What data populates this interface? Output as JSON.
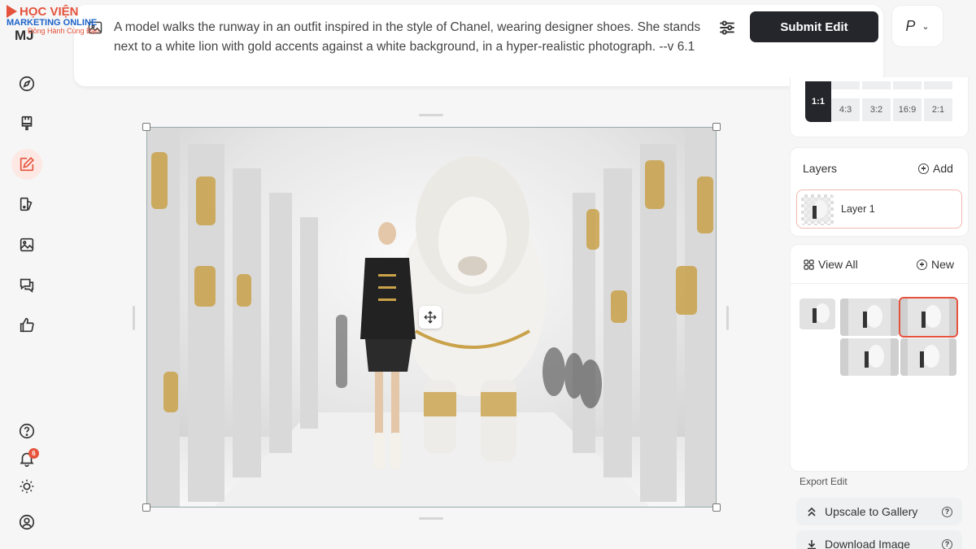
{
  "app": {
    "logo": "MJ"
  },
  "watermark": {
    "line1": "HỌC VIỆN",
    "line2": "MARKETING ONLINE",
    "line3": "Đồng Hành Cùng Bạn"
  },
  "sidebar": {
    "items": [
      {
        "icon": "compass-icon"
      },
      {
        "icon": "paintbrush-icon"
      },
      {
        "icon": "edit-icon",
        "active": true
      },
      {
        "icon": "palette-icon"
      },
      {
        "icon": "image-icon"
      },
      {
        "icon": "chat-icon"
      },
      {
        "icon": "thumbs-up-icon"
      }
    ],
    "bottom": [
      {
        "icon": "help-icon"
      },
      {
        "icon": "bell-icon",
        "badge": "6"
      },
      {
        "icon": "sun-icon"
      },
      {
        "icon": "profile-icon"
      }
    ]
  },
  "prompt": {
    "text": "A model walks the runway in an outfit inspired in the style of Chanel, wearing designer shoes. She stands next to a white lion with gold accents against a white background, in a hyper-realistic photograph. --v 6.1"
  },
  "toolbar": {
    "submit_label": "Submit Edit",
    "profile_label": "P"
  },
  "aspect_ratios": {
    "active": "1:1",
    "options": [
      "4:3",
      "3:2",
      "16:9",
      "2:1"
    ]
  },
  "layers": {
    "title": "Layers",
    "add_label": "Add",
    "items": [
      {
        "label": "Layer 1"
      }
    ]
  },
  "gallery": {
    "view_all_label": "View All",
    "new_label": "New"
  },
  "export": {
    "title": "Export Edit",
    "upscale_label": "Upscale to Gallery",
    "download_label": "Download Image"
  },
  "colors": {
    "accent": "#e5533d",
    "dark_button": "#24262b"
  }
}
